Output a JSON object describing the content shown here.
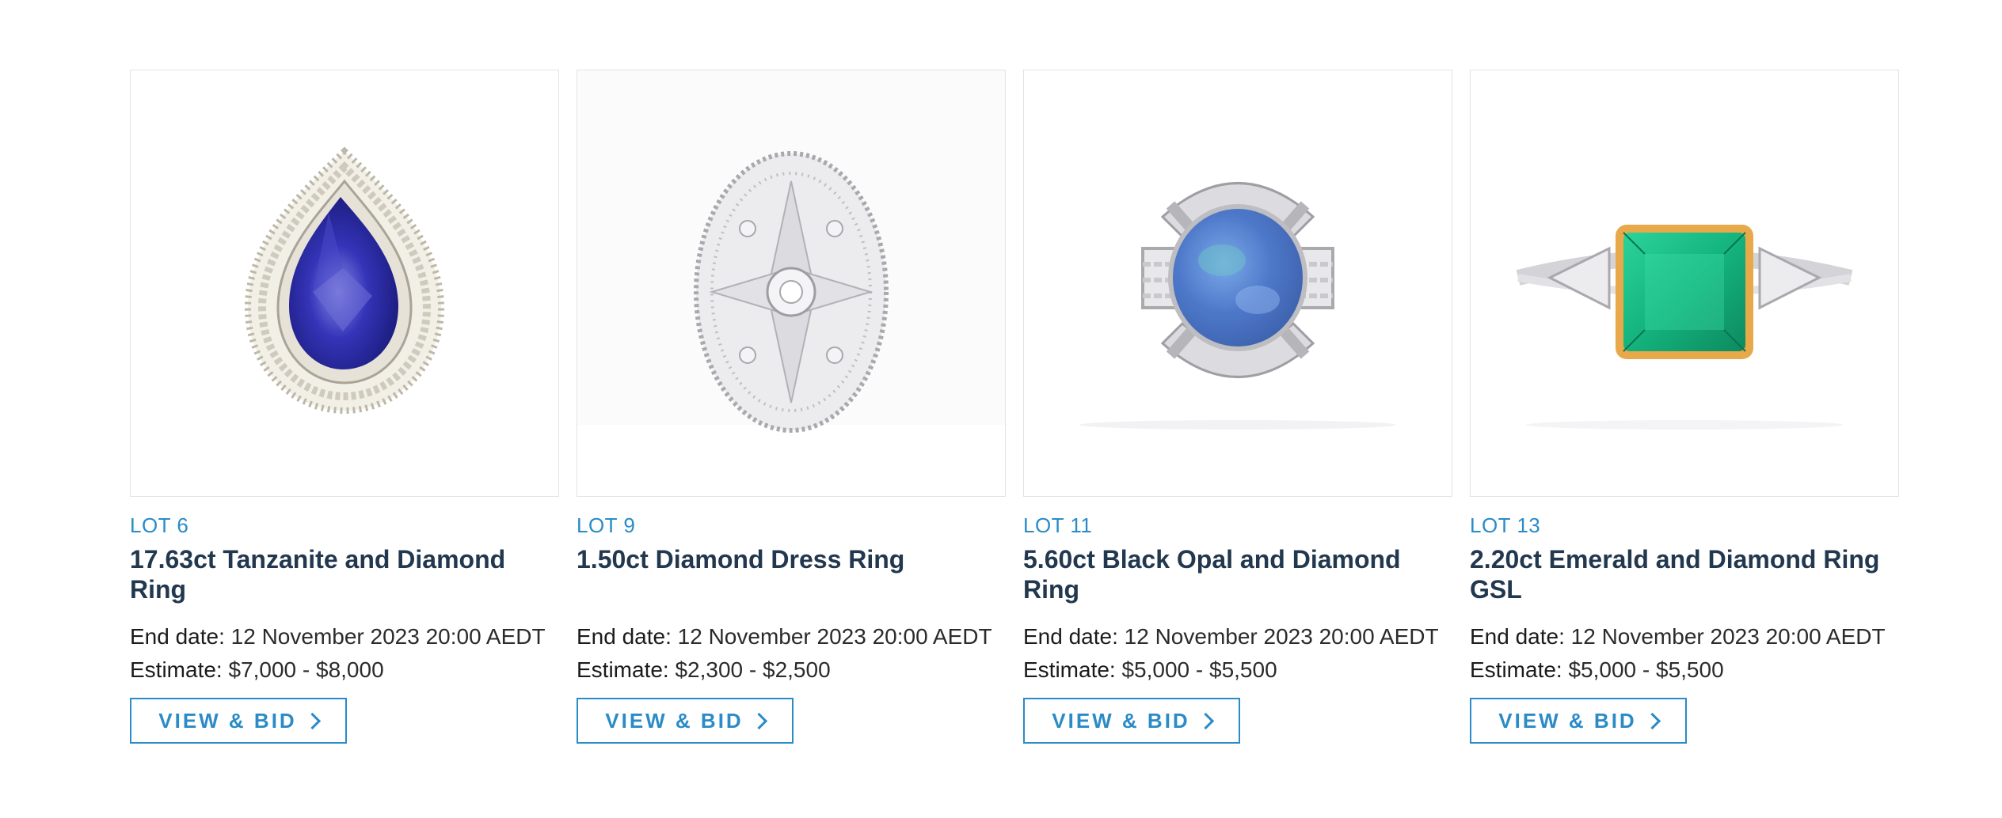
{
  "lots": [
    {
      "lot_label": "LOT 6",
      "title": "17.63ct Tanzanite and Diamond Ring",
      "end_label": "End date:",
      "end_value": "12 November 2023 20:00 AEDT",
      "estimate_label": "Estimate:",
      "estimate_value": "$7,000 - $8,000",
      "button_label": "VIEW & BID",
      "image_icon": "tanzanite-ring-image",
      "stone_color": "#2a2a9e"
    },
    {
      "lot_label": "LOT 9",
      "title": "1.50ct Diamond Dress Ring",
      "end_label": "End date:",
      "end_value": "12 November 2023 20:00 AEDT",
      "estimate_label": "Estimate:",
      "estimate_value": "$2,300 - $2,500",
      "button_label": "VIEW & BID",
      "image_icon": "diamond-dress-ring-image",
      "stone_color": "#d9d9dc"
    },
    {
      "lot_label": "LOT 11",
      "title": "5.60ct Black Opal and Diamond Ring",
      "end_label": "End date:",
      "end_value": "12 November 2023 20:00 AEDT",
      "estimate_label": "Estimate:",
      "estimate_value": "$5,000 - $5,500",
      "button_label": "VIEW & BID",
      "image_icon": "black-opal-ring-image",
      "stone_color": "#4d78c9"
    },
    {
      "lot_label": "LOT 13",
      "title": "2.20ct Emerald and Diamond Ring GSL",
      "end_label": "End date:",
      "end_value": "12 November 2023 20:00 AEDT",
      "estimate_label": "Estimate:",
      "estimate_value": "$5,000 - $5,500",
      "button_label": "VIEW & BID",
      "image_icon": "emerald-ring-image",
      "stone_color": "#14b37e"
    }
  ],
  "colors": {
    "accent": "#2a8bc7",
    "title": "#22384f",
    "text": "#2b2b2b",
    "border": "#e3e3e3"
  }
}
